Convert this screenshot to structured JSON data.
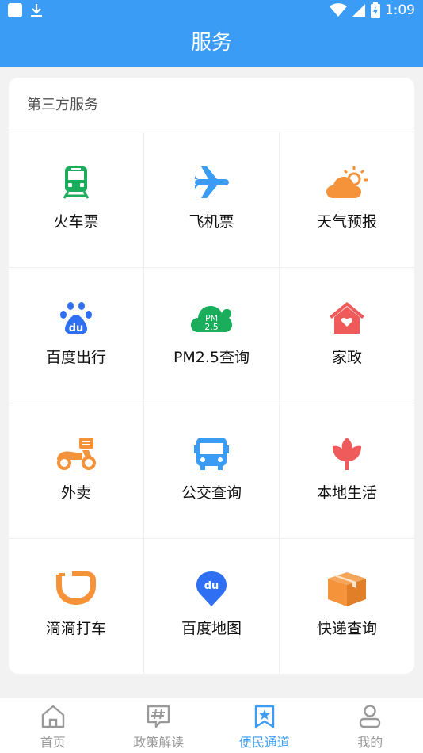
{
  "status_bar": {
    "time": "1:09"
  },
  "app_bar": {
    "title": "服务"
  },
  "section": {
    "title": "第三方服务",
    "items": [
      {
        "label": "火车票",
        "icon": "train-icon",
        "color": "#1aad5b"
      },
      {
        "label": "飞机票",
        "icon": "airplane-icon",
        "color": "#3b9cf5"
      },
      {
        "label": "天气预报",
        "icon": "weather-icon",
        "color": "#f5933b"
      },
      {
        "label": "百度出行",
        "icon": "baidu-paw-icon",
        "color": "#2f6ff3"
      },
      {
        "label": "PM2.5查询",
        "icon": "pm25-cloud-icon",
        "color": "#1aad5b"
      },
      {
        "label": "家政",
        "icon": "house-heart-icon",
        "color": "#ef5a5a"
      },
      {
        "label": "外卖",
        "icon": "scooter-icon",
        "color": "#f5933b"
      },
      {
        "label": "公交查询",
        "icon": "bus-icon",
        "color": "#3b9cf5"
      },
      {
        "label": "本地生活",
        "icon": "tulip-icon",
        "color": "#ef5a5a"
      },
      {
        "label": "滴滴打车",
        "icon": "didi-icon",
        "color": "#f5933b"
      },
      {
        "label": "百度地图",
        "icon": "baidu-map-pin-icon",
        "color": "#2f6ff3"
      },
      {
        "label": "快递查询",
        "icon": "package-icon",
        "color": "#f5933b"
      }
    ]
  },
  "tab_bar": {
    "items": [
      {
        "label": "首页",
        "icon": "home-icon",
        "active": false
      },
      {
        "label": "政策解读",
        "icon": "hashtag-chat-icon",
        "active": false
      },
      {
        "label": "便民通道",
        "icon": "star-bookmark-icon",
        "active": true
      },
      {
        "label": "我的",
        "icon": "user-icon",
        "active": false
      }
    ]
  },
  "colors": {
    "primary": "#3b9cf5",
    "background": "#f2f2f2",
    "tab_inactive": "#999999"
  }
}
